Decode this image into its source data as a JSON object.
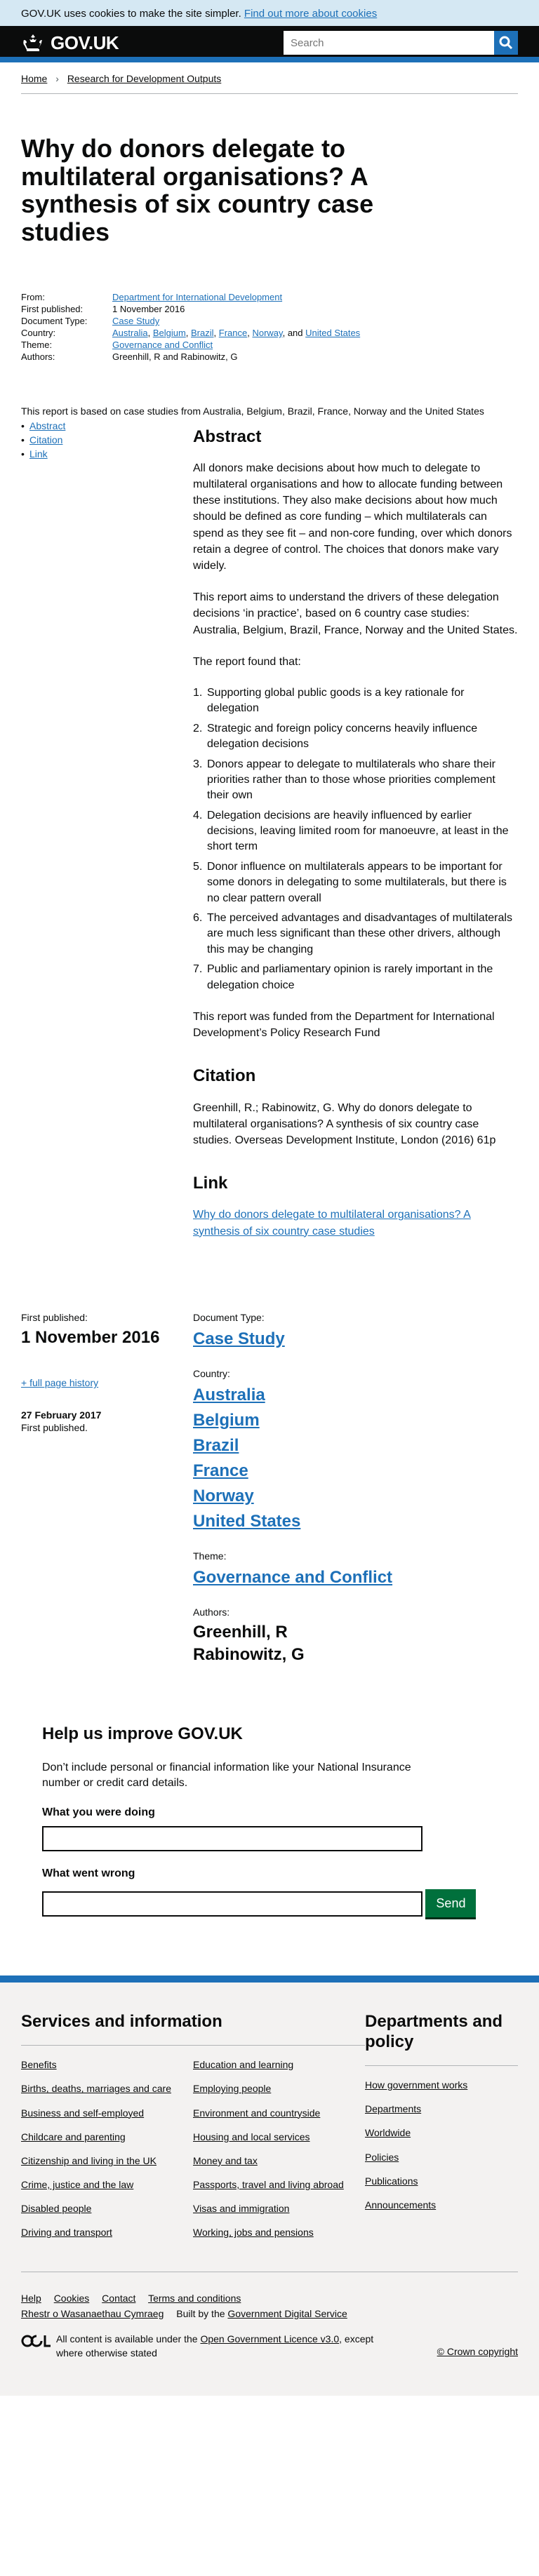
{
  "cookie_banner": {
    "text": "GOV.UK uses cookies to make the site simpler.",
    "link": "Find out more about cookies"
  },
  "header": {
    "logo": "GOV.UK",
    "search_placeholder": "Search",
    "search_icon": "search-icon"
  },
  "breadcrumbs": [
    "Home",
    "Research for Development Outputs"
  ],
  "title": "Why do donors delegate to multilateral organisations? A synthesis of six country case studies",
  "metadata": {
    "from_label": "From:",
    "from": "Department for International Development",
    "first_published_label": "First published:",
    "first_published": "1 November 2016",
    "doc_type_label": "Document Type:",
    "doc_type": "Case Study",
    "country_label": "Country:",
    "countries": [
      "Australia",
      "Belgium",
      "Brazil",
      "France",
      "Norway",
      "United States"
    ],
    "and_text": "and",
    "theme_label": "Theme:",
    "theme": "Governance and Conflict",
    "authors_label": "Authors:",
    "authors": "Greenhill, R and Rabinowitz, G"
  },
  "intro": "This report is based on case studies from Australia, Belgium, Brazil, France, Norway and the United States",
  "toc": [
    "Abstract",
    "Citation",
    "Link"
  ],
  "abstract": {
    "heading": "Abstract",
    "p1": "All donors make decisions about how much to delegate to multilateral organisations and how to allocate funding between these institutions. They also make decisions about how much should be defined as core funding – which multilaterals can spend as they see fit – and non-core funding, over which donors retain a degree of control. The choices that donors make vary widely.",
    "p2": "This report aims to understand the drivers of these delegation decisions ‘in practice’, based on 6 country case studies: Australia, Belgium, Brazil, France, Norway and the United States.",
    "p3": "The report found that:",
    "findings": [
      "Supporting global public goods is a key rationale for delegation",
      "Strategic and foreign policy concerns heavily influence delegation decisions",
      "Donors appear to delegate to multilaterals who share their priorities rather than to those whose priorities complement their own",
      "Delegation decisions are heavily influenced by earlier decisions, leaving limited room for manoeuvre, at least in the short term",
      "Donor influence on multilaterals appears to be important for some donors in delegating to some multilaterals, but there is no clear pattern overall",
      "The perceived advantages and disadvantages of multilaterals are much less significant than these other drivers, although this may be changing",
      "Public and parliamentary opinion is rarely important in the delegation choice"
    ],
    "p4": "This report was funded from the Department for International Development’s Policy Research Fund"
  },
  "citation": {
    "heading": "Citation",
    "text": "Greenhill, R.; Rabinowitz, G. Why do donors delegate to multilateral organisations? A synthesis of six country case studies. Overseas Development Institute, London (2016) 61p"
  },
  "link_section": {
    "heading": "Link",
    "link": "Why do donors delegate to multilateral organisations? A synthesis of six country case studies"
  },
  "bottom": {
    "first_published_label": "First published:",
    "first_published": "1 November 2016",
    "history_link": "+ full page history",
    "history_date": "27 February 2017",
    "history_note": "First published.",
    "doc_type_label": "Document Type:",
    "doc_type": "Case Study",
    "country_label": "Country:",
    "countries": [
      "Australia",
      "Belgium",
      "Brazil",
      "France",
      "Norway",
      "United States"
    ],
    "theme_label": "Theme:",
    "theme": "Governance and Conflict",
    "authors_label": "Authors:",
    "authors": [
      "Greenhill, R",
      "Rabinowitz, G"
    ]
  },
  "improve": {
    "heading": "Help us improve GOV.UK",
    "hint": "Don’t include personal or financial information like your National Insurance number or credit card details.",
    "doing_label": "What you were doing",
    "wrong_label": "What went wrong",
    "send": "Send"
  },
  "footer": {
    "services_heading": "Services and information",
    "services_col1": [
      "Benefits",
      "Births, deaths, marriages and care",
      "Business and self-employed",
      "Childcare and parenting",
      "Citizenship and living in the UK",
      "Crime, justice and the law",
      "Disabled people",
      "Driving and transport"
    ],
    "services_col2": [
      "Education and learning",
      "Employing people",
      "Environment and countryside",
      "Housing and local services",
      "Money and tax",
      "Passports, travel and living abroad",
      "Visas and immigration",
      "Working, jobs and pensions"
    ],
    "dept_heading": "Departments and policy",
    "dept_links": [
      "How government works",
      "Departments",
      "Worldwide",
      "Policies",
      "Publications",
      "Announcements"
    ],
    "meta_links": [
      "Help",
      "Cookies",
      "Contact",
      "Terms and conditions",
      "Rhestr o Wasanaethau Cymraeg"
    ],
    "built_by_prefix": "Built by the",
    "built_by_link": "Government Digital Service",
    "licence_prefix": "All content is available under the",
    "licence_link": "Open Government Licence v3.0",
    "licence_suffix": ", except where otherwise stated",
    "copyright": "© Crown copyright"
  },
  "colors": {
    "link": "#1d70b8",
    "header_bg": "#0b0c0c",
    "send_button": "#00703c",
    "cookie_bg": "#d5e8f3",
    "footer_bg": "#f3f2f1"
  }
}
